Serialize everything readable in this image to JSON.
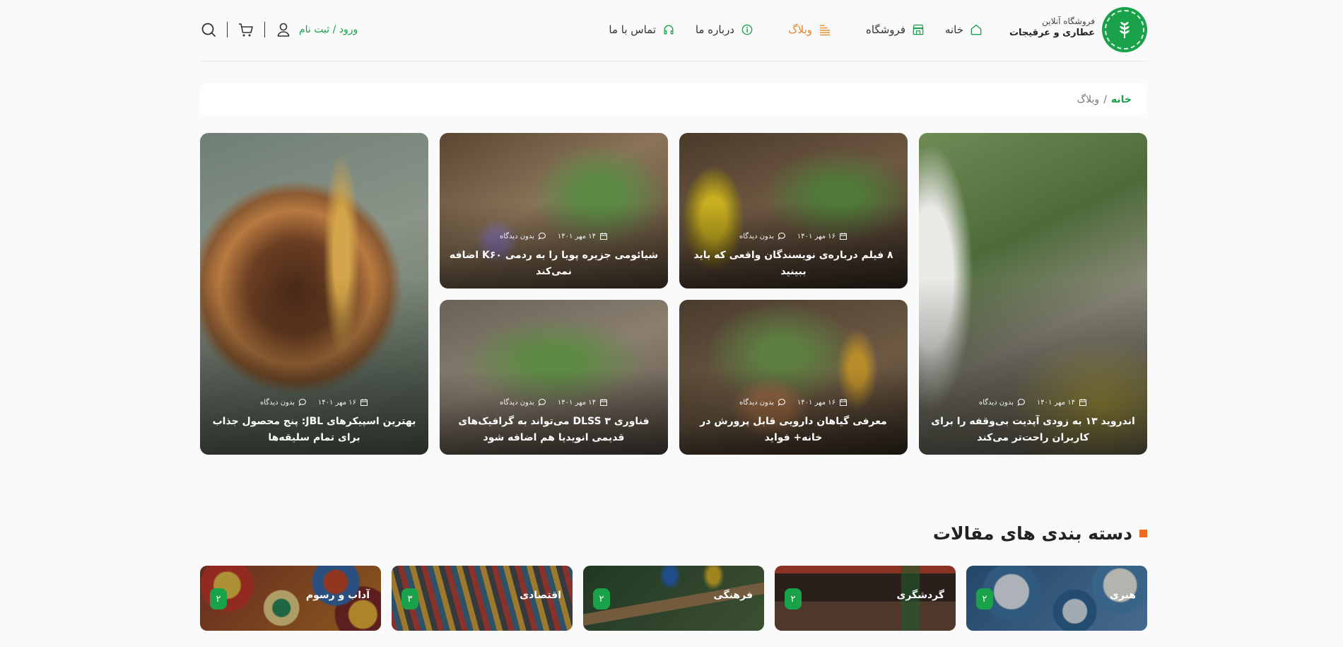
{
  "brand": {
    "line1": "فروشگاه آنلاین",
    "line2": "عطاری و عرقیجات",
    "color": "#1aa24a"
  },
  "nav": {
    "items": [
      {
        "label": "خانه",
        "icon": "home-icon"
      },
      {
        "label": "فروشگاه",
        "icon": "store-icon"
      },
      {
        "label": "وبلاگ",
        "icon": "blog-list-icon",
        "active": true
      },
      {
        "label": "درباره ما",
        "icon": "info-icon"
      },
      {
        "label": "تماس با ما",
        "icon": "headphones-icon"
      }
    ],
    "active_color": "#e8852a"
  },
  "tools": {
    "login_label": "ورود / ثبت نام",
    "icons": [
      "search-icon",
      "cart-icon",
      "user-icon"
    ]
  },
  "breadcrumb": {
    "home": "خانه",
    "separator": "/",
    "current": "وبلاگ"
  },
  "posts": [
    {
      "title": "اندروید ۱۳ به زودی آپدیت بی‌وقفه را برای کاربران راحت‌تر می‌کند",
      "date": "۱۴ مهر ۱۴۰۱",
      "comments": "بدون دیدگاه"
    },
    {
      "title": "۸ فیلم درباره‌ی نویسندگان واقعی که باید ببینید",
      "date": "۱۶ مهر ۱۴۰۱",
      "comments": "بدون دیدگاه"
    },
    {
      "title": "شیائومی جزیره پویا را به ردمی K۶۰ اضافه نمی‌کند",
      "date": "۱۴ مهر ۱۴۰۱",
      "comments": "بدون دیدگاه"
    },
    {
      "title": "معرفی گیاهان دارویی قابل پرورش در خانه+ فواید",
      "date": "۱۶ مهر ۱۴۰۱",
      "comments": "بدون دیدگاه"
    },
    {
      "title": "فناوری DLSS ۳ می‌تواند به گرافیک‌های قدیمی انویدیا هم اضافه شود",
      "date": "۱۴ مهر ۱۴۰۱",
      "comments": "بدون دیدگاه"
    },
    {
      "title": "بهترین اسپیکرهای JBL: پنج محصول جذاب برای تمام سلیقه‌ها",
      "date": "۱۶ مهر ۱۴۰۱",
      "comments": "بدون دیدگاه"
    }
  ],
  "categories_section": {
    "title": "دسته بندی های مقالات",
    "accent": "#ee6b1f",
    "items": [
      {
        "name": "هنری",
        "count": "۲"
      },
      {
        "name": "گردشگری",
        "count": "۲"
      },
      {
        "name": "فرهنگی",
        "count": "۲"
      },
      {
        "name": "اقتصادی",
        "count": "۳"
      },
      {
        "name": "آداب و رسوم",
        "count": "۲"
      }
    ]
  }
}
